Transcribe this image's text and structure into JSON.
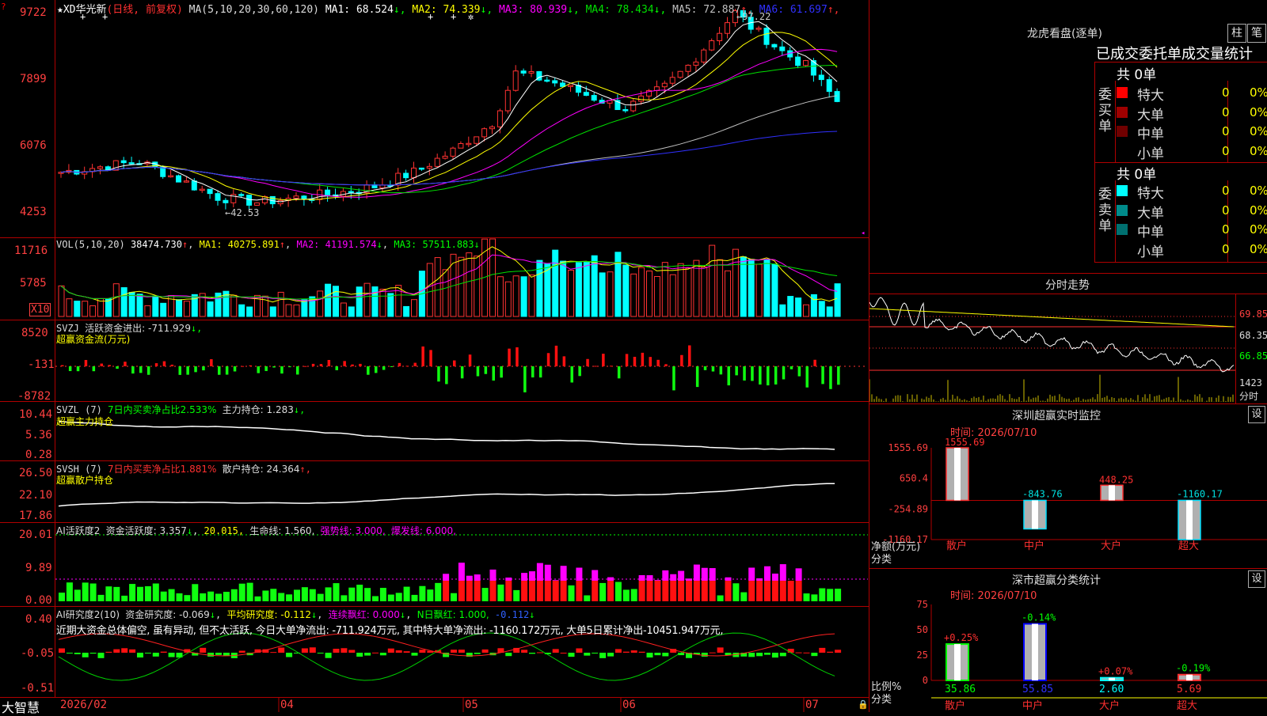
{
  "stock": {
    "star": "★",
    "name": "XD华光新",
    "mode": "(日线, 前复权)"
  },
  "main": {
    "ma_title": "MA(5,10,20,30,60,120)",
    "ma": [
      {
        "label": "MA1:",
        "value": "68.524",
        "arrow": "↓",
        "color": "#ffffff"
      },
      {
        "label": "MA2:",
        "value": "74.339",
        "arrow": "↓",
        "color": "#ffff00"
      },
      {
        "label": "MA3:",
        "value": "80.939",
        "arrow": "↓",
        "color": "#ff00ff"
      },
      {
        "label": "MA4:",
        "value": "78.434",
        "arrow": "↓",
        "color": "#00e000"
      },
      {
        "label": "MA5:",
        "value": "72.887",
        "arrow": "↑",
        "color": "#c0c0c0"
      },
      {
        "label": "MA6:",
        "value": "61.697",
        "arrow": "↑",
        "color": "#3030ff"
      }
    ],
    "yticks": [
      "9722",
      "7899",
      "6076",
      "4253"
    ],
    "high_note": "97.22",
    "low_note": "42.53"
  },
  "vol": {
    "title": "VOL(5,10,20)",
    "value": "38474.730",
    "ma1": "MA1: 40275.891",
    "ma2": "MA2: 41191.574",
    "ma3": "MA3: 57511.883",
    "yticks": [
      "11716",
      "5785"
    ],
    "unit": "X10"
  },
  "svzj": {
    "title": "SVZJ",
    "desc": "活跃资金进出: -711.929",
    "arrow": "↓,",
    "sub": "超赢资金流(万元)",
    "yticks": [
      "8520",
      "-131",
      "-8782"
    ]
  },
  "svzl": {
    "title": "SVZL (7)",
    "desc": "7日内买卖净占比2.533%",
    "extra": "主力持仓: 1.283",
    "arrow": "↓,",
    "sub": "超赢主力持仓",
    "yticks": [
      "10.44",
      "5.36",
      "0.28"
    ]
  },
  "svsh": {
    "title": "SVSH (7)",
    "desc": "7日内买卖净占比1.881%",
    "extra": "散户持仓: 24.364",
    "arrow": "↑,",
    "sub": "超赢散户持仓",
    "yticks": [
      "26.50",
      "22.10",
      "17.86"
    ]
  },
  "ai1": {
    "title": "AI活跃度2",
    "a": "资金活跃度: 3.357",
    "b": "20.015,",
    "c": "生命线: 1.560,",
    "d": "强势线: 3.000,",
    "e": "爆发线: 6.000,",
    "yticks": [
      "20.01",
      "9.89",
      "0.00"
    ]
  },
  "ai2": {
    "title": "AI研究度2(10)",
    "a": "资金研究度: -0.069",
    "b": "平均研究度: -0.112",
    "c": "连续飘红: 0.000",
    "d": "N日飘红: 1.000,",
    "e": "-0.112",
    "summary": "近期大资金总体偏空, 虽有异动, 但不太活跃, 今日大单净流出: -711.924万元, 其中特大单净流出: -1160.172万元, 大单5日累计净出-10451.947万元,",
    "yticks": [
      "0.40",
      "-0.05",
      "-0.51"
    ]
  },
  "xaxis": {
    "brand": "大智慧",
    "labels": [
      "2026/02",
      "04",
      "05",
      "06",
      "07"
    ]
  },
  "lhb": {
    "title": "龙虎看盘(逐单)",
    "btn_a": "柱",
    "btn_b": "笔",
    "header": "已成交委托单成交量统计",
    "buy": {
      "side": "委买单",
      "total": "共 0单",
      "rows": [
        {
          "name": "特大",
          "n": "0",
          "p": "0%",
          "color": "#ff0000"
        },
        {
          "name": "大单",
          "n": "0",
          "p": "0%",
          "color": "#a00000"
        },
        {
          "name": "中单",
          "n": "0",
          "p": "0%",
          "color": "#700000"
        },
        {
          "name": "小单",
          "n": "0",
          "p": "0%",
          "color": ""
        }
      ]
    },
    "sell": {
      "side": "委卖单",
      "total": "共 0单",
      "rows": [
        {
          "name": "特大",
          "n": "0",
          "p": "0%",
          "color": "#00ffff"
        },
        {
          "name": "大单",
          "n": "0",
          "p": "0%",
          "color": "#008b8b"
        },
        {
          "name": "中单",
          "n": "0",
          "p": "0%",
          "color": "#007070"
        },
        {
          "name": "小单",
          "n": "0",
          "p": "0%",
          "color": ""
        }
      ]
    }
  },
  "intraday": {
    "title": "分时走势",
    "prices": [
      "69.85",
      "68.35",
      "66.85"
    ],
    "vol": "1423",
    "vol_unit": "分时"
  },
  "szmon": {
    "title": "深圳超赢实时监控",
    "set": "设",
    "time": "时间: 2026/07/10",
    "yticks": [
      "1555.69",
      "650.4",
      "-254.89",
      "-1160.17"
    ],
    "ylabel": "净额(万元)",
    "xlabel": "分类",
    "cats": [
      "散户",
      "中户",
      "大户",
      "超大"
    ],
    "vals": [
      "1555.69",
      "-843.76",
      "448.25",
      "-1160.17"
    ]
  },
  "szcls": {
    "title": "深市超赢分类统计",
    "set": "设",
    "time": "时间: 2026/07/10",
    "yticks": [
      "75",
      "50",
      "25",
      "0"
    ],
    "ylabel": "比例%",
    "xlabel": "分类",
    "cats": [
      "散户",
      "中户",
      "大户",
      "超大"
    ],
    "pcts": [
      "35.86",
      "55.85",
      "2.60",
      "5.69"
    ],
    "chg": [
      "+0.25%",
      "-0.14%",
      "+0.07%",
      "-0.19%"
    ]
  },
  "chart_data": [
    {
      "type": "bar",
      "title": "深圳超赢实时监控",
      "xlabel": "分类",
      "ylabel": "净额(万元)",
      "categories": [
        "散户",
        "中户",
        "大户",
        "超大"
      ],
      "values": [
        1555.69,
        -843.76,
        448.25,
        -1160.17
      ],
      "ylim": [
        -1160.17,
        1555.69
      ]
    },
    {
      "type": "bar",
      "title": "深市超赢分类统计",
      "xlabel": "分类",
      "ylabel": "比例%",
      "categories": [
        "散户",
        "中户",
        "大户",
        "超大"
      ],
      "values": [
        35.86,
        55.85,
        2.6,
        5.69
      ],
      "ylim": [
        0,
        75
      ]
    }
  ]
}
